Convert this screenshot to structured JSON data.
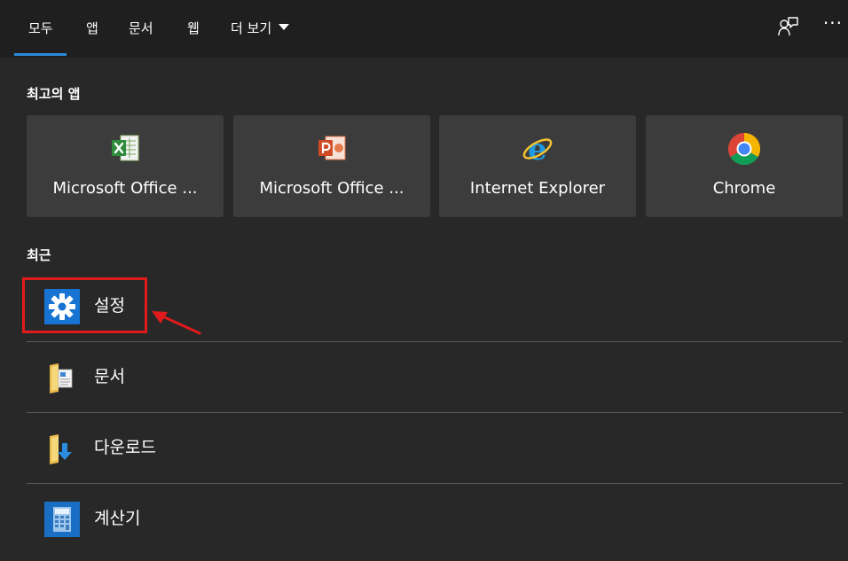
{
  "tabs": {
    "all": "모두",
    "apps": "앱",
    "documents": "문서",
    "web": "웹",
    "more": "더 보기"
  },
  "header_icons": [
    "feedback-icon",
    "more-options-icon"
  ],
  "more_glyph": "···",
  "top_apps": {
    "title": "최고의 앱",
    "items": [
      {
        "label": "Microsoft Office ...",
        "icon": "excel-icon"
      },
      {
        "label": "Microsoft Office ...",
        "icon": "powerpoint-icon"
      },
      {
        "label": "Internet Explorer",
        "icon": "internet-explorer-icon"
      },
      {
        "label": "Chrome",
        "icon": "chrome-icon"
      }
    ]
  },
  "recent": {
    "title": "최근",
    "items": [
      {
        "label": "설정",
        "icon": "settings-gear-icon"
      },
      {
        "label": "문서",
        "icon": "documents-folder-icon"
      },
      {
        "label": "다운로드",
        "icon": "downloads-folder-icon"
      },
      {
        "label": "계산기",
        "icon": "calculator-icon"
      }
    ]
  },
  "colors": {
    "background": "#282828",
    "topbar": "#1f1f1f",
    "tile": "#3c3c3c",
    "accent": "#2a89d8",
    "annotation": "#e01b1b"
  }
}
